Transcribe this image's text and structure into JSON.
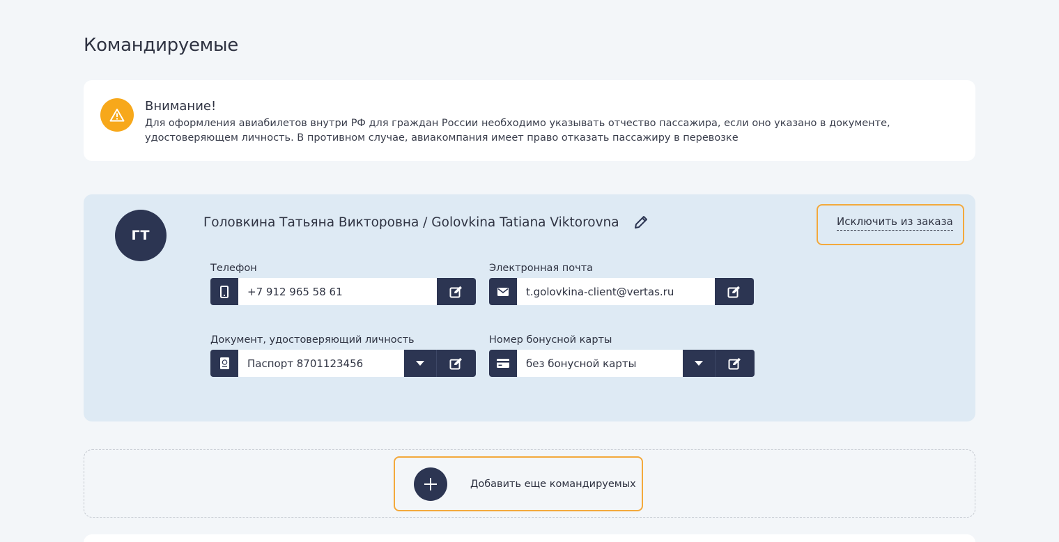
{
  "page": {
    "title": "Командируемые"
  },
  "alert": {
    "icon": "warning-icon",
    "title": "Внимание!",
    "text": "Для оформления авиабилетов внутри РФ для граждан России необходимо указывать отчество пассажира, если оно указано в документе, удостоверяющем личность. В противном случае, авиакомпания имеет право отказать пассажиру в перевозке",
    "color": "#f7a81b"
  },
  "traveler": {
    "initials": "ГТ",
    "name": "Головкина Татьяна Викторовна / Golovkina Tatiana Viktorovna",
    "exclude_label": "Исключить из заказа",
    "phone": {
      "label": "Телефон",
      "value": "+7 912 965 58 61",
      "icon": "phone-icon"
    },
    "email": {
      "label": "Электронная почта",
      "value": "t.golovkina-client@vertas.ru",
      "icon": "envelope-icon"
    },
    "document": {
      "label": "Документ, удостоверяющий личность",
      "value": "Паспорт  8701123456",
      "icon": "passport-icon"
    },
    "bonus_card": {
      "label": "Номер бонусной карты",
      "value": "без бонусной карты",
      "icon": "credit-card-icon"
    }
  },
  "add_more": {
    "label": "Добавить еще командируемых",
    "icon": "plus-icon"
  },
  "colors": {
    "accent": "#f3a93c",
    "dark": "#2c3552",
    "card_bg": "#deeaf4",
    "page_bg": "#f3f6f9"
  }
}
